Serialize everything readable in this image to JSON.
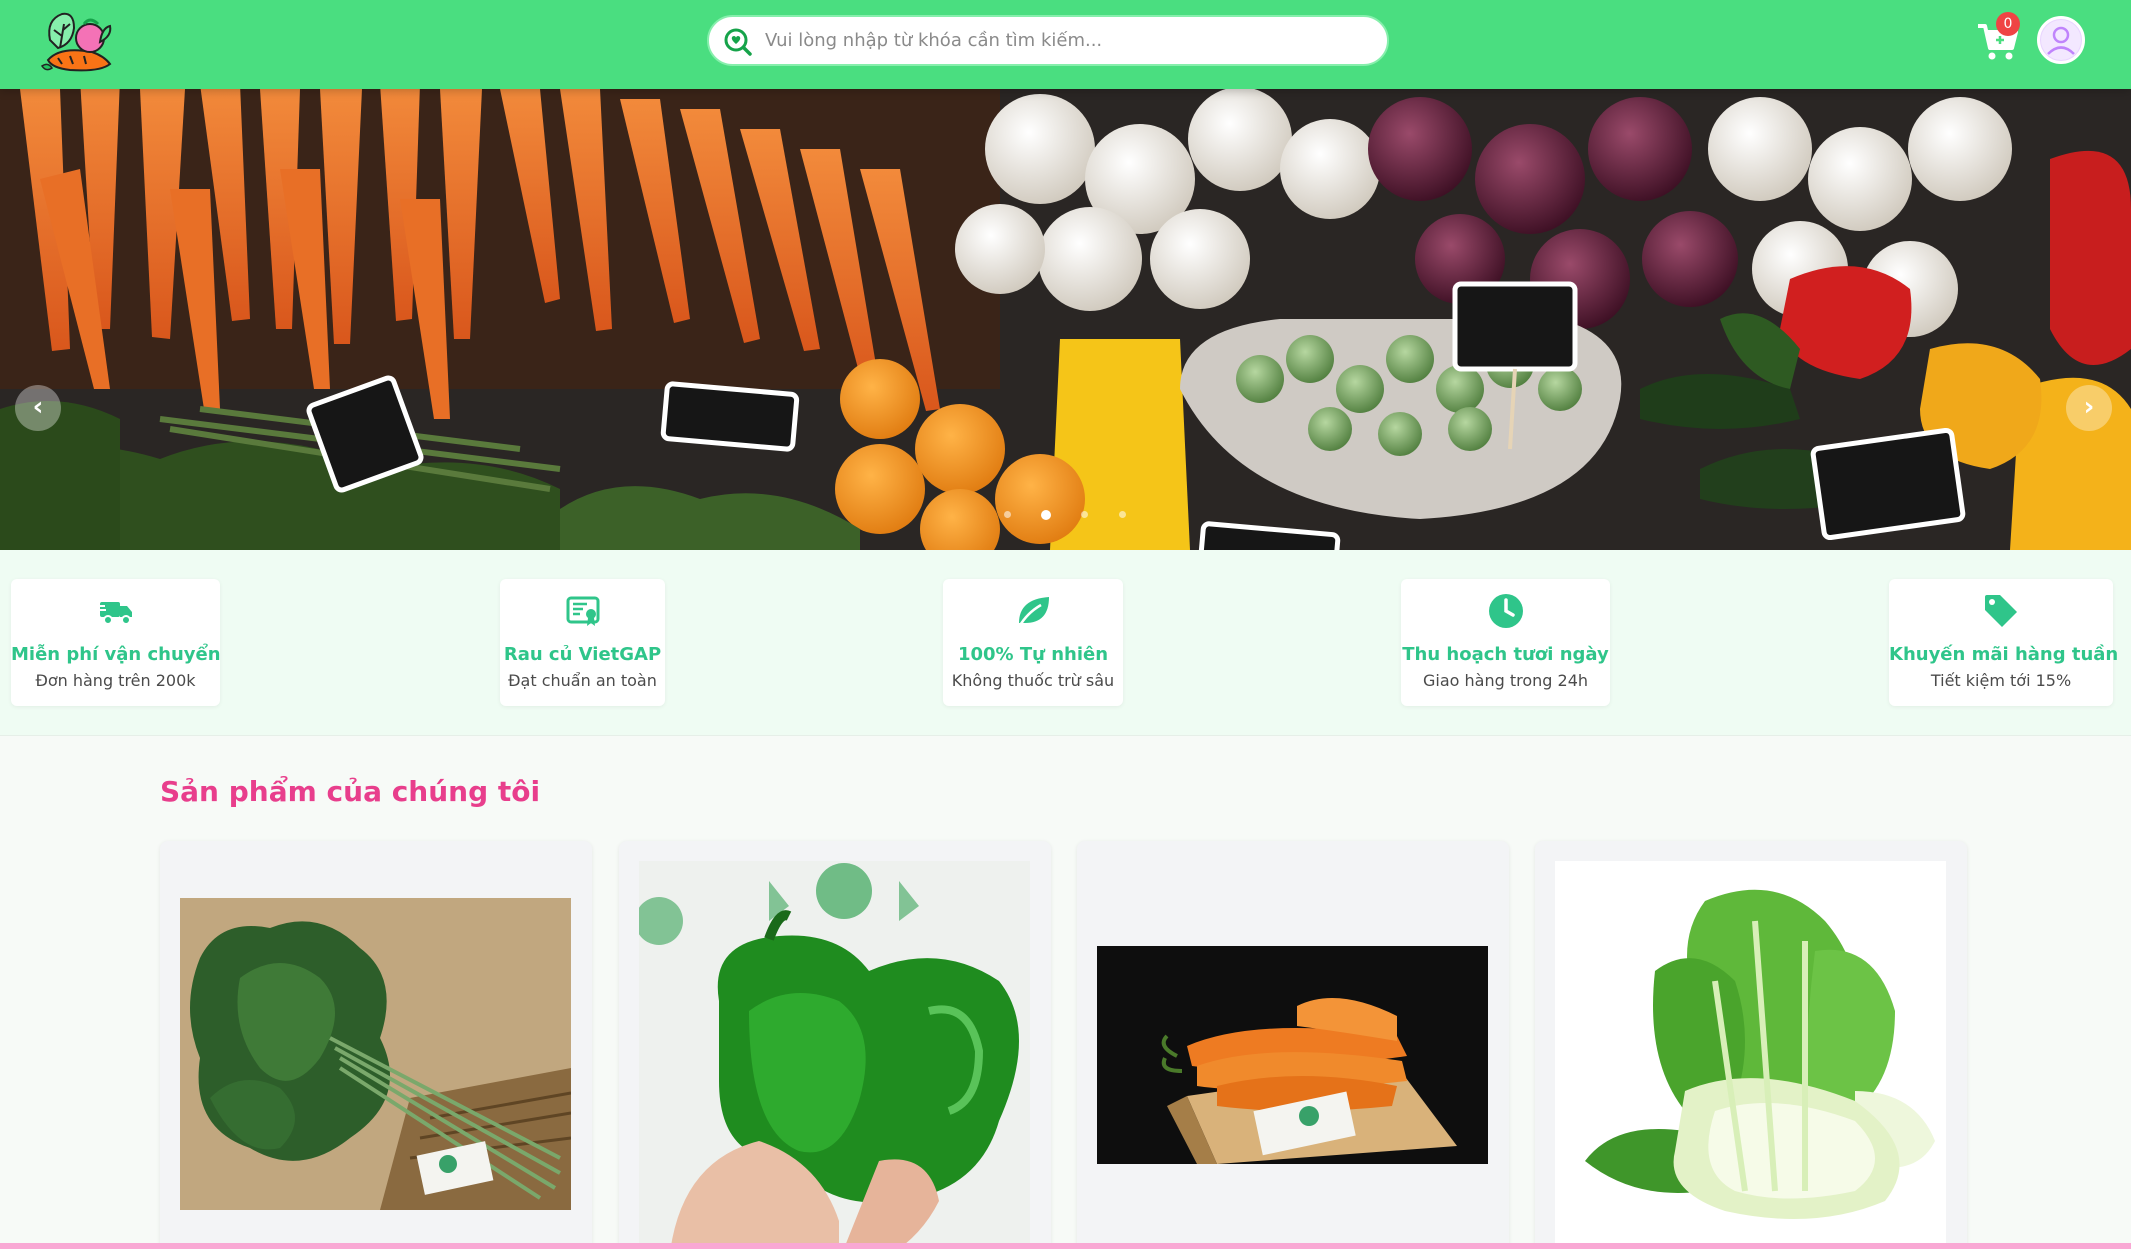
{
  "header": {
    "logo_alt": "logo",
    "search_placeholder": "Vui lòng nhập từ khóa cần tìm kiếm...",
    "cart_count": "0",
    "icons": {
      "logo": "vegetable-logo-icon",
      "search": "search-heart-icon",
      "cart": "cart-icon",
      "avatar": "user-avatar-icon"
    }
  },
  "hero": {
    "prev": "‹",
    "next": "›",
    "slide_count": 4,
    "active_slide": 2
  },
  "features": [
    {
      "title": "Miễn phí vận chuyển",
      "subtitle": "Đơn hàng trên 200k",
      "icon": "truck-icon"
    },
    {
      "title": "Rau củ VietGAP",
      "subtitle": "Đạt chuẩn an toàn",
      "icon": "certificate-icon"
    },
    {
      "title": "100% Tự nhiên",
      "subtitle": "Không thuốc trừ sâu",
      "icon": "leaf-icon"
    },
    {
      "title": "Thu hoạch tươi ngày",
      "subtitle": "Giao hàng trong 24h",
      "icon": "clock-icon"
    },
    {
      "title": "Khuyến mãi hàng tuần",
      "subtitle": "Tiết kiệm tới 15%",
      "icon": "tag-icon"
    }
  ],
  "products": {
    "title": "Sản phẩm của chúng tôi",
    "items": [
      {
        "image": "kale-image"
      },
      {
        "image": "green-pepper-image"
      },
      {
        "image": "carrot-image"
      },
      {
        "image": "bok-choy-image"
      }
    ]
  },
  "colors": {
    "header": "#4ade80",
    "accent_green": "#2fc58a",
    "title_pink": "#e83e8c",
    "badge_red": "#ef4444"
  }
}
